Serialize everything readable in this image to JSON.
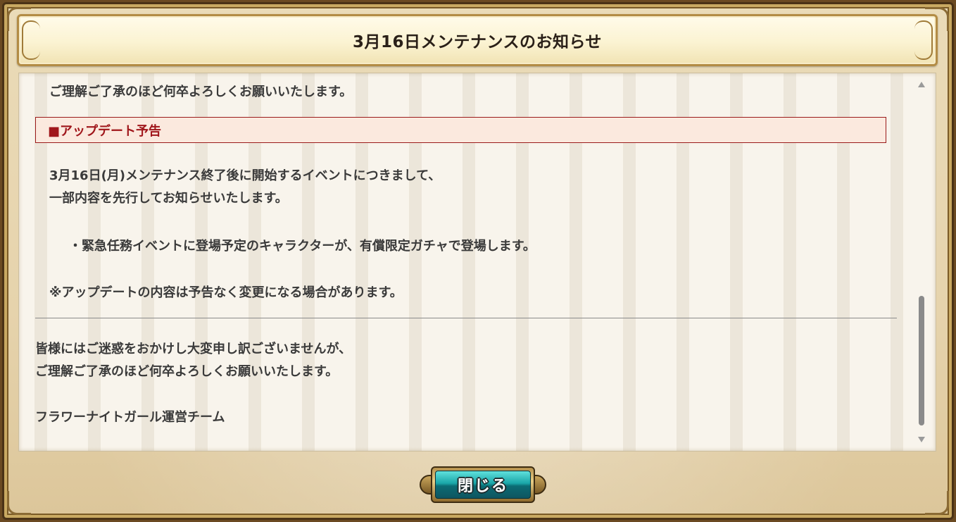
{
  "dialog": {
    "title": "3月16日メンテナンスのお知らせ",
    "close_label": "閉じる"
  },
  "content": {
    "intro_line": "ご理解ご了承のほど何卒よろしくお願いいたします。",
    "update_section": {
      "header": "■アップデート予告",
      "line1": "3月16日(月)メンテナンス終了後に開始するイベントにつきまして、",
      "line2": "一部内容を先行してお知らせいたします。",
      "bullet": "・緊急任務イベントに登場予定のキャラクターが、有償限定ガチャで登場します。",
      "note": "※アップデートの内容は予告なく変更になる場合があります。"
    },
    "closing": {
      "line1": "皆様にはご迷惑をおかけし大変申し訳ございませんが、",
      "line2": "ご理解ご了承のほど何卒よろしくお願いいたします。",
      "signature": "フラワーナイトガール運営チーム"
    }
  },
  "colors": {
    "section_header_text": "#a0161b",
    "section_header_border": "#9a1a1a",
    "section_header_bg": "#fbe9de",
    "body_text": "#3a3a3a",
    "button_face": "#1aa6a8"
  }
}
